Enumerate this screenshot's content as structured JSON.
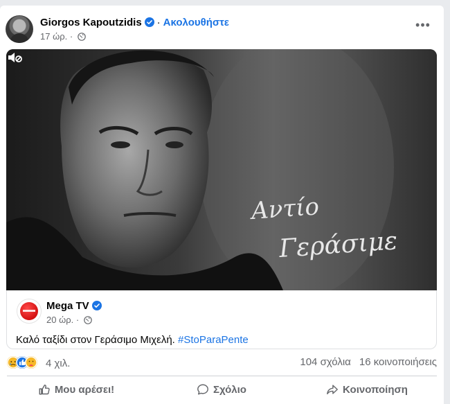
{
  "post": {
    "author": "Giorgos Kapoutzidis",
    "separator": "·",
    "follow_label": "Ακολουθήστε",
    "time": "17 ώρ.",
    "more_label": "•••"
  },
  "media": {
    "overlay_line1": "Αντίο",
    "overlay_line2": "Γεράσιμε"
  },
  "shared": {
    "page_name": "Mega TV",
    "time": "20 ώρ.",
    "text": "Καλό ταξίδι στον Γεράσιμο Μιχελή. ",
    "hashtag": "#StoParaPente"
  },
  "stats": {
    "reactions_count": "4 χιλ.",
    "comments": "104 σχόλια",
    "shares": "16 κοινοποιήσεις"
  },
  "actions": {
    "like": "Μου αρέσει!",
    "comment": "Σχόλιο",
    "share": "Κοινοποίηση"
  },
  "colors": {
    "accent": "#1b74e4",
    "secondary_text": "#65676b"
  }
}
